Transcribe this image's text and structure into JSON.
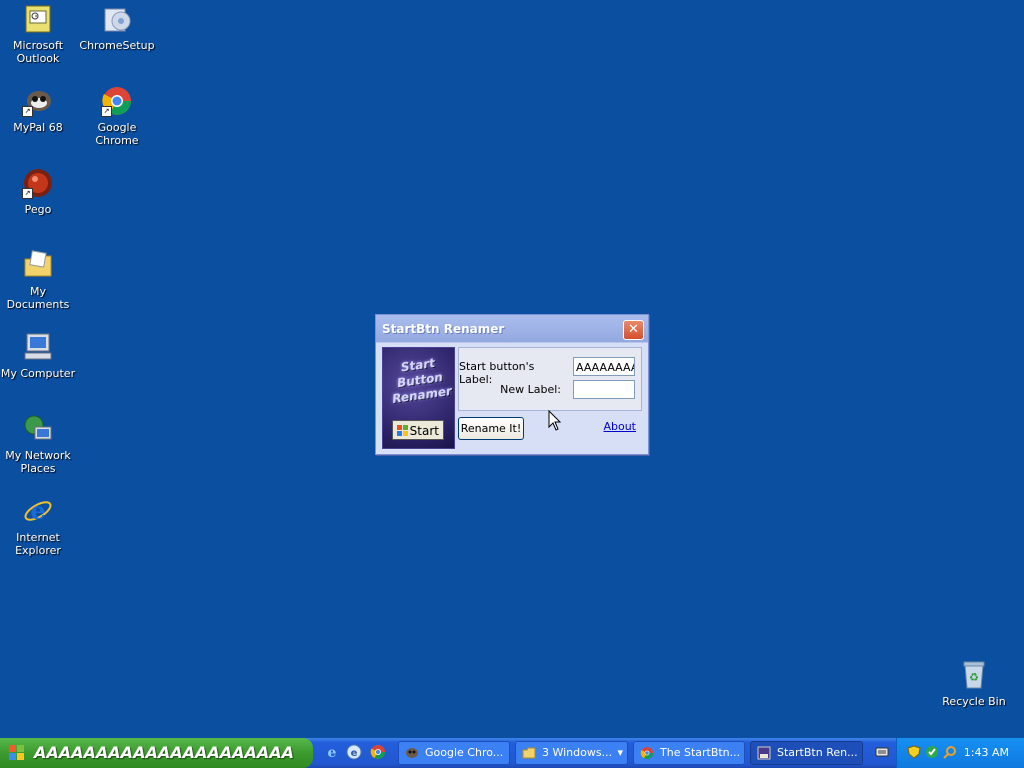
{
  "desktop": {
    "icons": [
      {
        "label": "Microsoft Outlook",
        "icon": "outlook-icon"
      },
      {
        "label": "ChromeSetup",
        "icon": "chrome-setup-icon"
      },
      {
        "label": "MyPal 68",
        "icon": "mypal-icon"
      },
      {
        "label": "Google Chrome",
        "icon": "chrome-icon"
      },
      {
        "label": "Pego",
        "icon": "pego-icon"
      },
      {
        "label": "My Documents",
        "icon": "my-documents-icon"
      },
      {
        "label": "My Computer",
        "icon": "my-computer-icon"
      },
      {
        "label": "My Network Places",
        "icon": "network-places-icon"
      },
      {
        "label": "Internet Explorer",
        "icon": "internet-explorer-icon"
      },
      {
        "label": "Recycle Bin",
        "icon": "recycle-bin-icon"
      }
    ]
  },
  "dialog": {
    "title": "StartBtn Renamer",
    "banner_text": "Start Button Renamer",
    "preview_label": "Start",
    "current_label_caption": "Start button's Label:",
    "current_label_value": "AAAAAAAAAAAAAAAAAAAAA",
    "new_label_caption": "New Label:",
    "new_label_value": "",
    "rename_button": "Rename It!",
    "about_link": "About"
  },
  "taskbar": {
    "start_label": "AAAAAAAAAAAAAAAAAAAAA",
    "quick_launch": [
      "internet-explorer-icon",
      "edge-icon",
      "chrome-icon"
    ],
    "buttons": [
      {
        "label": "Google Chro...",
        "icon": "mypal-icon",
        "active": false
      },
      {
        "label": "3 Windows...",
        "icon": "folder-icon",
        "active": false
      },
      {
        "label": "The StartBtn...",
        "icon": "chrome-icon",
        "active": false
      },
      {
        "label": "StartBtn Ren...",
        "icon": "app-icon",
        "active": true
      }
    ],
    "clock": "1:43 AM"
  },
  "colors": {
    "desktop": "#0b4fa0",
    "taskbar": "#245edb",
    "start_green": "#3c9a2e",
    "tray": "#0f79e0"
  }
}
